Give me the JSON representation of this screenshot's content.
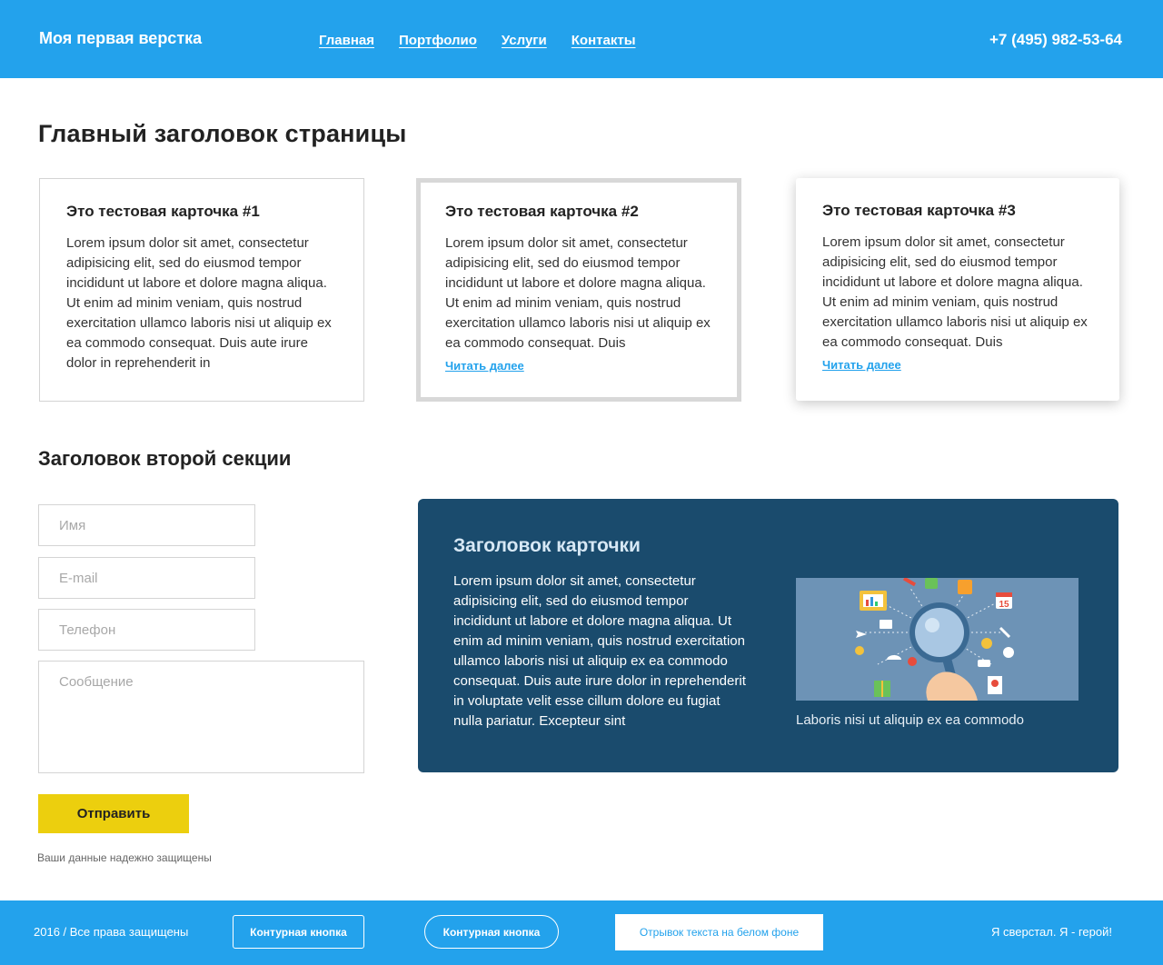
{
  "header": {
    "logo": "Моя первая верстка",
    "nav": [
      "Главная",
      "Портфолио",
      "Услуги",
      "Контакты"
    ],
    "phone": "+7 (495) 982-53-64"
  },
  "main": {
    "title": "Главный заголовок страницы",
    "cards": [
      {
        "title": "Это тестовая карточка #1",
        "text": "Lorem ipsum dolor sit amet, consectetur adipisicing elit, sed do eiusmod tempor incididunt ut labore et dolore magna aliqua. Ut enim ad minim veniam, quis nostrud exercitation ullamco laboris nisi ut aliquip ex ea commodo consequat. Duis aute irure dolor in reprehenderit in"
      },
      {
        "title": "Это тестовая карточка #2",
        "text": "Lorem ipsum dolor sit amet, consectetur adipisicing elit, sed do eiusmod tempor incididunt ut labore et dolore magna aliqua. Ut enim ad minim veniam, quis nostrud exercitation ullamco laboris nisi ut aliquip ex ea commodo consequat. Duis",
        "link": "Читать далее"
      },
      {
        "title": "Это тестовая карточка #3",
        "text": "Lorem ipsum dolor sit amet, consectetur adipisicing elit, sed do eiusmod tempor incididunt ut labore et dolore magna aliqua. Ut enim ad minim veniam, quis nostrud exercitation ullamco laboris nisi ut aliquip ex ea commodo consequat. Duis",
        "link": "Читать далее"
      }
    ]
  },
  "section2": {
    "title": "Заголовок второй секции",
    "form": {
      "name_placeholder": "Имя",
      "email_placeholder": "E-mail",
      "phone_placeholder": "Телефон",
      "message_placeholder": "Сообщение",
      "submit_label": "Отправить",
      "note": "Ваши данные надежно защищены"
    },
    "card": {
      "title": "Заголовок карточки",
      "text": "Lorem ipsum dolor sit amet, consectetur adipisicing elit, sed do eiusmod tempor incididunt ut labore et dolore magna aliqua. Ut enim ad minim veniam, quis nostrud exercitation ullamco laboris nisi ut aliquip ex ea commodo consequat. Duis aute irure dolor in reprehenderit in voluptate velit esse cillum dolore eu fugiat nulla pariatur. Excepteur sint",
      "image_icon": "magnifier-illustration",
      "calendar_number": "15",
      "caption": "Laboris nisi ut aliquip ex ea commodo"
    }
  },
  "footer": {
    "copyright": "2016 / Все права защищены",
    "button1": "Контурная кнопка",
    "button2": "Контурная кнопка",
    "white_text": "Отрывок текста на белом фоне",
    "right_text": "Я сверстал. Я - герой!"
  },
  "colors": {
    "primary": "#23a2ec",
    "accent": "#eccf0e",
    "dark_card": "#1a4b6d"
  }
}
